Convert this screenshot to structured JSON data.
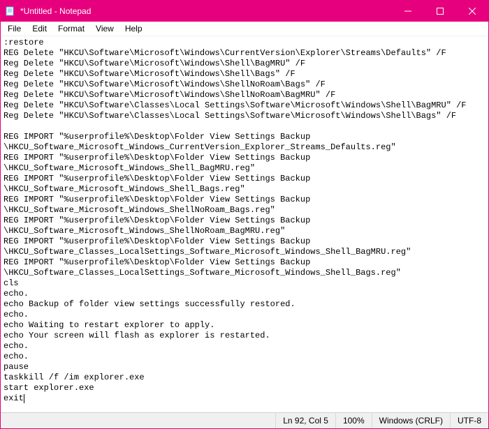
{
  "window": {
    "title": "*Untitled - Notepad"
  },
  "menu": {
    "file": "File",
    "edit": "Edit",
    "format": "Format",
    "view": "View",
    "help": "Help"
  },
  "content": {
    "lines": [
      ":restore",
      "REG Delete \"HKCU\\Software\\Microsoft\\Windows\\CurrentVersion\\Explorer\\Streams\\Defaults\" /F",
      "Reg Delete \"HKCU\\Software\\Microsoft\\Windows\\Shell\\BagMRU\" /F",
      "Reg Delete \"HKCU\\Software\\Microsoft\\Windows\\Shell\\Bags\" /F",
      "Reg Delete \"HKCU\\Software\\Microsoft\\Windows\\ShellNoRoam\\Bags\" /F",
      "Reg Delete \"HKCU\\Software\\Microsoft\\Windows\\ShellNoRoam\\BagMRU\" /F",
      "Reg Delete \"HKCU\\Software\\Classes\\Local Settings\\Software\\Microsoft\\Windows\\Shell\\BagMRU\" /F",
      "Reg Delete \"HKCU\\Software\\Classes\\Local Settings\\Software\\Microsoft\\Windows\\Shell\\Bags\" /F",
      "",
      "REG IMPORT \"%userprofile%\\Desktop\\Folder View Settings Backup",
      "\\HKCU_Software_Microsoft_Windows_CurrentVersion_Explorer_Streams_Defaults.reg\"",
      "REG IMPORT \"%userprofile%\\Desktop\\Folder View Settings Backup",
      "\\HKCU_Software_Microsoft_Windows_Shell_BagMRU.reg\"",
      "REG IMPORT \"%userprofile%\\Desktop\\Folder View Settings Backup",
      "\\HKCU_Software_Microsoft_Windows_Shell_Bags.reg\"",
      "REG IMPORT \"%userprofile%\\Desktop\\Folder View Settings Backup",
      "\\HKCU_Software_Microsoft_Windows_ShellNoRoam_Bags.reg\"",
      "REG IMPORT \"%userprofile%\\Desktop\\Folder View Settings Backup",
      "\\HKCU_Software_Microsoft_Windows_ShellNoRoam_BagMRU.reg\"",
      "REG IMPORT \"%userprofile%\\Desktop\\Folder View Settings Backup",
      "\\HKCU_Software_Classes_LocalSettings_Software_Microsoft_Windows_Shell_BagMRU.reg\"",
      "REG IMPORT \"%userprofile%\\Desktop\\Folder View Settings Backup",
      "\\HKCU_Software_Classes_LocalSettings_Software_Microsoft_Windows_Shell_Bags.reg\"",
      "cls",
      "echo.",
      "echo Backup of folder view settings successfully restored.",
      "echo.",
      "echo Waiting to restart explorer to apply.",
      "echo Your screen will flash as explorer is restarted.",
      "echo.",
      "echo.",
      "pause",
      "taskkill /f /im explorer.exe",
      "start explorer.exe",
      "exit"
    ]
  },
  "status": {
    "position": "Ln 92, Col 5",
    "zoom": "100%",
    "line_ending": "Windows (CRLF)",
    "encoding": "UTF-8"
  }
}
